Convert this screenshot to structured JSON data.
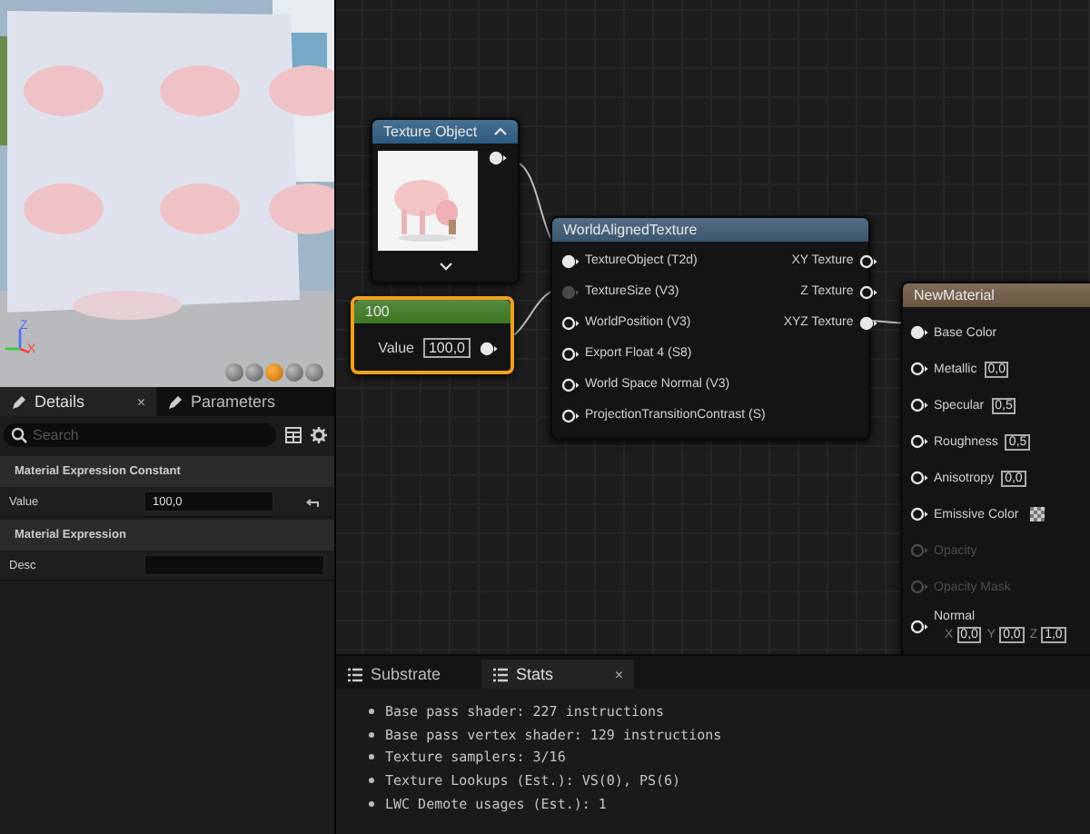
{
  "viewport": {
    "axes": [
      "Z",
      "X"
    ],
    "preview_buttons": [
      {
        "selected": false
      },
      {
        "selected": false
      },
      {
        "selected": true
      },
      {
        "selected": false
      },
      {
        "selected": false
      }
    ]
  },
  "details": {
    "tabs": [
      {
        "label": "Details",
        "selected": true,
        "close": "×"
      },
      {
        "label": "Parameters",
        "selected": false
      }
    ],
    "search": {
      "placeholder": "Search"
    },
    "sections": [
      {
        "title": "Material Expression Constant",
        "rows": [
          {
            "label": "Value",
            "value": "100,0",
            "resettable": true
          }
        ]
      },
      {
        "title": "Material Expression",
        "rows": [
          {
            "label": "Desc",
            "resettable": false
          }
        ]
      }
    ]
  },
  "graph": {
    "nodes": [
      {
        "kind": "texture_object",
        "title": "Texture Object",
        "color": "#2c5a80",
        "selected": false,
        "outputs": [
          {
            "connected": true
          }
        ]
      },
      {
        "kind": "constant",
        "title": "100",
        "color": "#3d7622",
        "selected": true,
        "inputs": [
          {
            "label": "Value",
            "value": "100,0"
          }
        ],
        "outputs": [
          {
            "connected": true
          }
        ]
      },
      {
        "kind": "function",
        "title": "WorldAlignedTexture",
        "color": "#3a5670",
        "selected": false,
        "inputs": [
          {
            "label": "TextureObject (T2d)",
            "connected": true,
            "disabled": false
          },
          {
            "label": "TextureSize (V3)",
            "connected": true,
            "disabled": true
          },
          {
            "label": "WorldPosition (V3)",
            "connected": false,
            "disabled": false
          },
          {
            "label": "Export Float 4 (S8)",
            "connected": false,
            "disabled": false
          },
          {
            "label": "World Space Normal (V3)",
            "connected": false,
            "disabled": false
          },
          {
            "label": "ProjectionTransitionContrast (S)",
            "connected": false,
            "disabled": false
          }
        ],
        "outputs": [
          {
            "label": "XY Texture",
            "connected": false
          },
          {
            "label": "Z Texture",
            "connected": false
          },
          {
            "label": "XYZ Texture",
            "connected": true
          }
        ]
      },
      {
        "kind": "material",
        "title": "NewMaterial",
        "color": "#6b5640",
        "selected": false,
        "inputs": [
          {
            "label": "Base Color",
            "connected": true,
            "disabled": false
          },
          {
            "label": "Metallic",
            "connected": false,
            "disabled": false,
            "value": "0,0"
          },
          {
            "label": "Specular",
            "connected": false,
            "disabled": false,
            "value": "0,5"
          },
          {
            "label": "Roughness",
            "connected": false,
            "disabled": false,
            "value": "0,5"
          },
          {
            "label": "Anisotropy",
            "connected": false,
            "disabled": false,
            "value": "0,0"
          },
          {
            "label": "Emissive Color",
            "connected": false,
            "disabled": false,
            "swatch": true
          },
          {
            "label": "Opacity",
            "connected": false,
            "disabled": true
          },
          {
            "label": "Opacity Mask",
            "connected": false,
            "disabled": true
          },
          {
            "label": "Normal",
            "connected": false,
            "disabled": false,
            "vector": [
              {
                "axis": "X",
                "value": "0,0"
              },
              {
                "axis": "Y",
                "value": "0,0"
              },
              {
                "axis": "Z",
                "value": "1,0"
              }
            ]
          }
        ]
      }
    ]
  },
  "bottom_panel": {
    "tabs": [
      {
        "label": "Substrate",
        "selected": false
      },
      {
        "label": "Stats",
        "selected": true,
        "close": "×"
      }
    ],
    "lines": [
      "Base pass shader: 227 instructions",
      "Base pass vertex shader: 129 instructions",
      "Texture samplers: 3/16",
      "Texture Lookups (Est.): VS(0), PS(6)",
      "LWC Demote usages (Est.): 1"
    ]
  }
}
